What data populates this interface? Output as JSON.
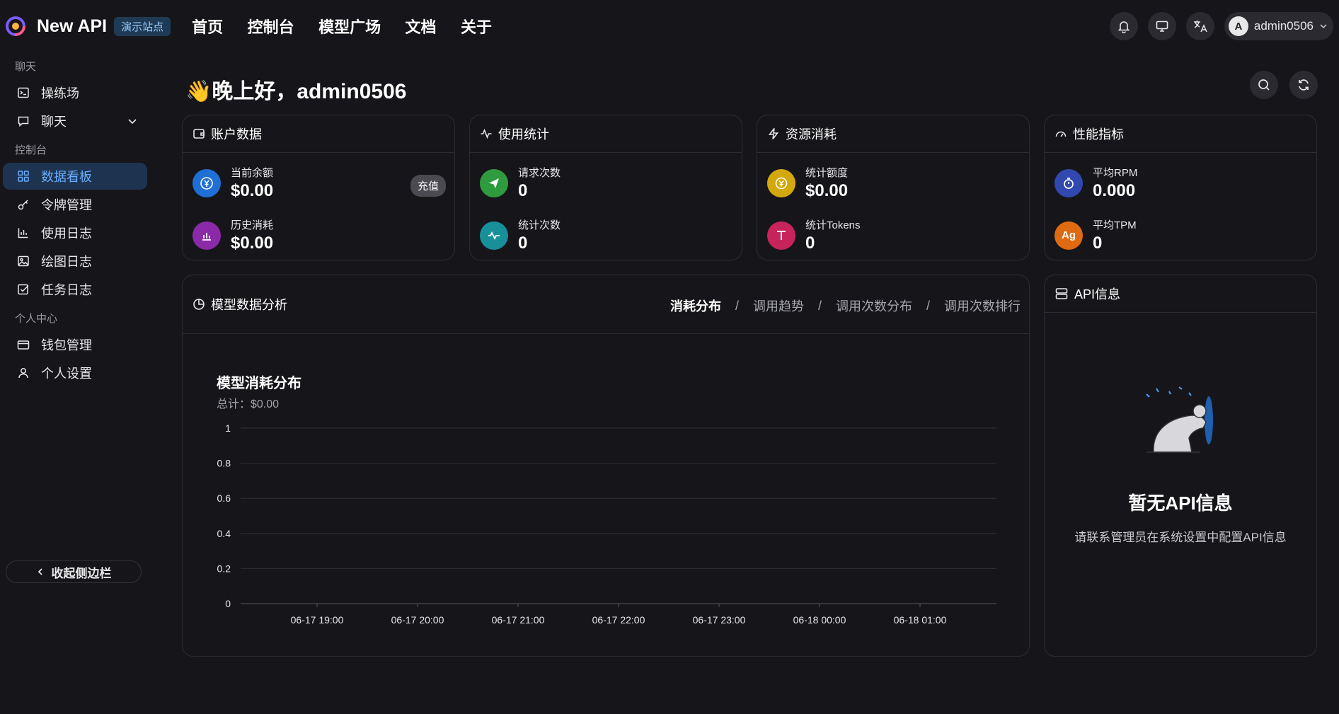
{
  "header": {
    "brand": "New API",
    "badge": "演示站点",
    "nav": [
      "首页",
      "控制台",
      "模型广场",
      "文档",
      "关于"
    ],
    "user": "admin0506",
    "avatar_letter": "A"
  },
  "sidebar": {
    "sections": [
      {
        "title": "聊天",
        "items": [
          {
            "label": "操练场",
            "icon": "terminal-icon"
          },
          {
            "label": "聊天",
            "icon": "chat-icon",
            "expandable": true
          }
        ]
      },
      {
        "title": "控制台",
        "items": [
          {
            "label": "数据看板",
            "icon": "grid-icon",
            "active": true
          },
          {
            "label": "令牌管理",
            "icon": "key-icon"
          },
          {
            "label": "使用日志",
            "icon": "bar-chart-icon"
          },
          {
            "label": "绘图日志",
            "icon": "image-icon"
          },
          {
            "label": "任务日志",
            "icon": "checkbox-icon"
          }
        ]
      },
      {
        "title": "个人中心",
        "items": [
          {
            "label": "钱包管理",
            "icon": "wallet-icon"
          },
          {
            "label": "个人设置",
            "icon": "user-icon"
          }
        ]
      }
    ],
    "collapse_label": "收起侧边栏"
  },
  "greeting": "晚上好，admin0506",
  "greeting_emoji": "👋",
  "cards": {
    "account": {
      "title": "账户数据",
      "recharge": "充值",
      "rows": [
        {
          "label": "当前余额",
          "value": "$0.00",
          "color": "#1f6fd6"
        },
        {
          "label": "历史消耗",
          "value": "$0.00",
          "color": "#8b2aa8"
        }
      ]
    },
    "usage": {
      "title": "使用统计",
      "rows": [
        {
          "label": "请求次数",
          "value": "0",
          "color": "#2e9c3e"
        },
        {
          "label": "统计次数",
          "value": "0",
          "color": "#17909a"
        }
      ]
    },
    "resource": {
      "title": "资源消耗",
      "rows": [
        {
          "label": "统计额度",
          "value": "$0.00",
          "color": "#d2a80c"
        },
        {
          "label": "统计Tokens",
          "value": "0",
          "color": "#c8245c"
        }
      ]
    },
    "performance": {
      "title": "性能指标",
      "rows": [
        {
          "label": "平均RPM",
          "value": "0.000",
          "color": "#3048b0"
        },
        {
          "label": "平均TPM",
          "value": "0",
          "color": "#de6a12"
        }
      ]
    }
  },
  "analysis": {
    "title": "模型数据分析",
    "tabs": [
      "消耗分布",
      "调用趋势",
      "调用次数分布",
      "调用次数排行"
    ],
    "active_tab": "消耗分布"
  },
  "chart_data": {
    "type": "bar",
    "title": "模型消耗分布",
    "subtitle": "总计：$0.00",
    "categories": [
      "06-17 19:00",
      "06-17 20:00",
      "06-17 21:00",
      "06-17 22:00",
      "06-17 23:00",
      "06-18 00:00",
      "06-18 01:00"
    ],
    "values": [
      0,
      0,
      0,
      0,
      0,
      0,
      0
    ],
    "yticks": [
      "0",
      "0.2",
      "0.4",
      "0.6",
      "0.8",
      "1"
    ],
    "ylim": [
      0,
      1
    ],
    "grid": true
  },
  "api_info": {
    "title": "API信息",
    "empty_title": "暂无API信息",
    "empty_desc": "请联系管理员在系统设置中配置API信息"
  },
  "colors": {
    "accent": "#6aaeff",
    "active_bg": "#1e3350",
    "background": "#16161a"
  }
}
